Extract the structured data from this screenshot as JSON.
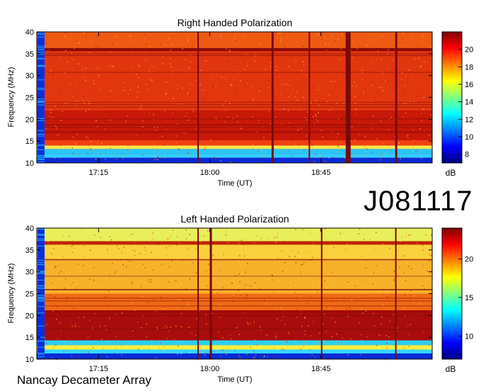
{
  "figure_label": "J081117",
  "footer_label": "Nancay Decameter Array",
  "colors": {
    "colormap": [
      "#00007f",
      "#0000ff",
      "#0080ff",
      "#00ffff",
      "#80ff80",
      "#ffff00",
      "#ff8000",
      "#ff0000",
      "#7f0000"
    ]
  },
  "chart_data": [
    {
      "type": "heatmap",
      "title": "Right Handed Polarization",
      "xlabel": "Time (UT)",
      "ylabel": "Frequency (MHz)",
      "colorbar_label": "dB",
      "xlim": [
        "16:50",
        "19:30"
      ],
      "ylim": [
        10,
        40
      ],
      "x_ticks": [
        "17:15",
        "18:00",
        "18:45"
      ],
      "y_ticks": [
        10,
        15,
        20,
        25,
        30,
        35,
        40
      ],
      "colorbar_ticks": [
        8,
        10,
        12,
        14,
        16,
        18,
        20
      ],
      "colorbar_range": [
        7,
        22
      ]
    },
    {
      "type": "heatmap",
      "title": "Left Handed Polarization",
      "xlabel": "Time (UT)",
      "ylabel": "Frequency (MHz)",
      "colorbar_label": "dB",
      "xlim": [
        "16:50",
        "19:30"
      ],
      "ylim": [
        10,
        40
      ],
      "x_ticks": [
        "17:15",
        "18:00",
        "18:45"
      ],
      "y_ticks": [
        10,
        15,
        20,
        25,
        30,
        35,
        40
      ],
      "colorbar_ticks": [
        10,
        15,
        20
      ],
      "colorbar_range": [
        7,
        24
      ]
    }
  ]
}
